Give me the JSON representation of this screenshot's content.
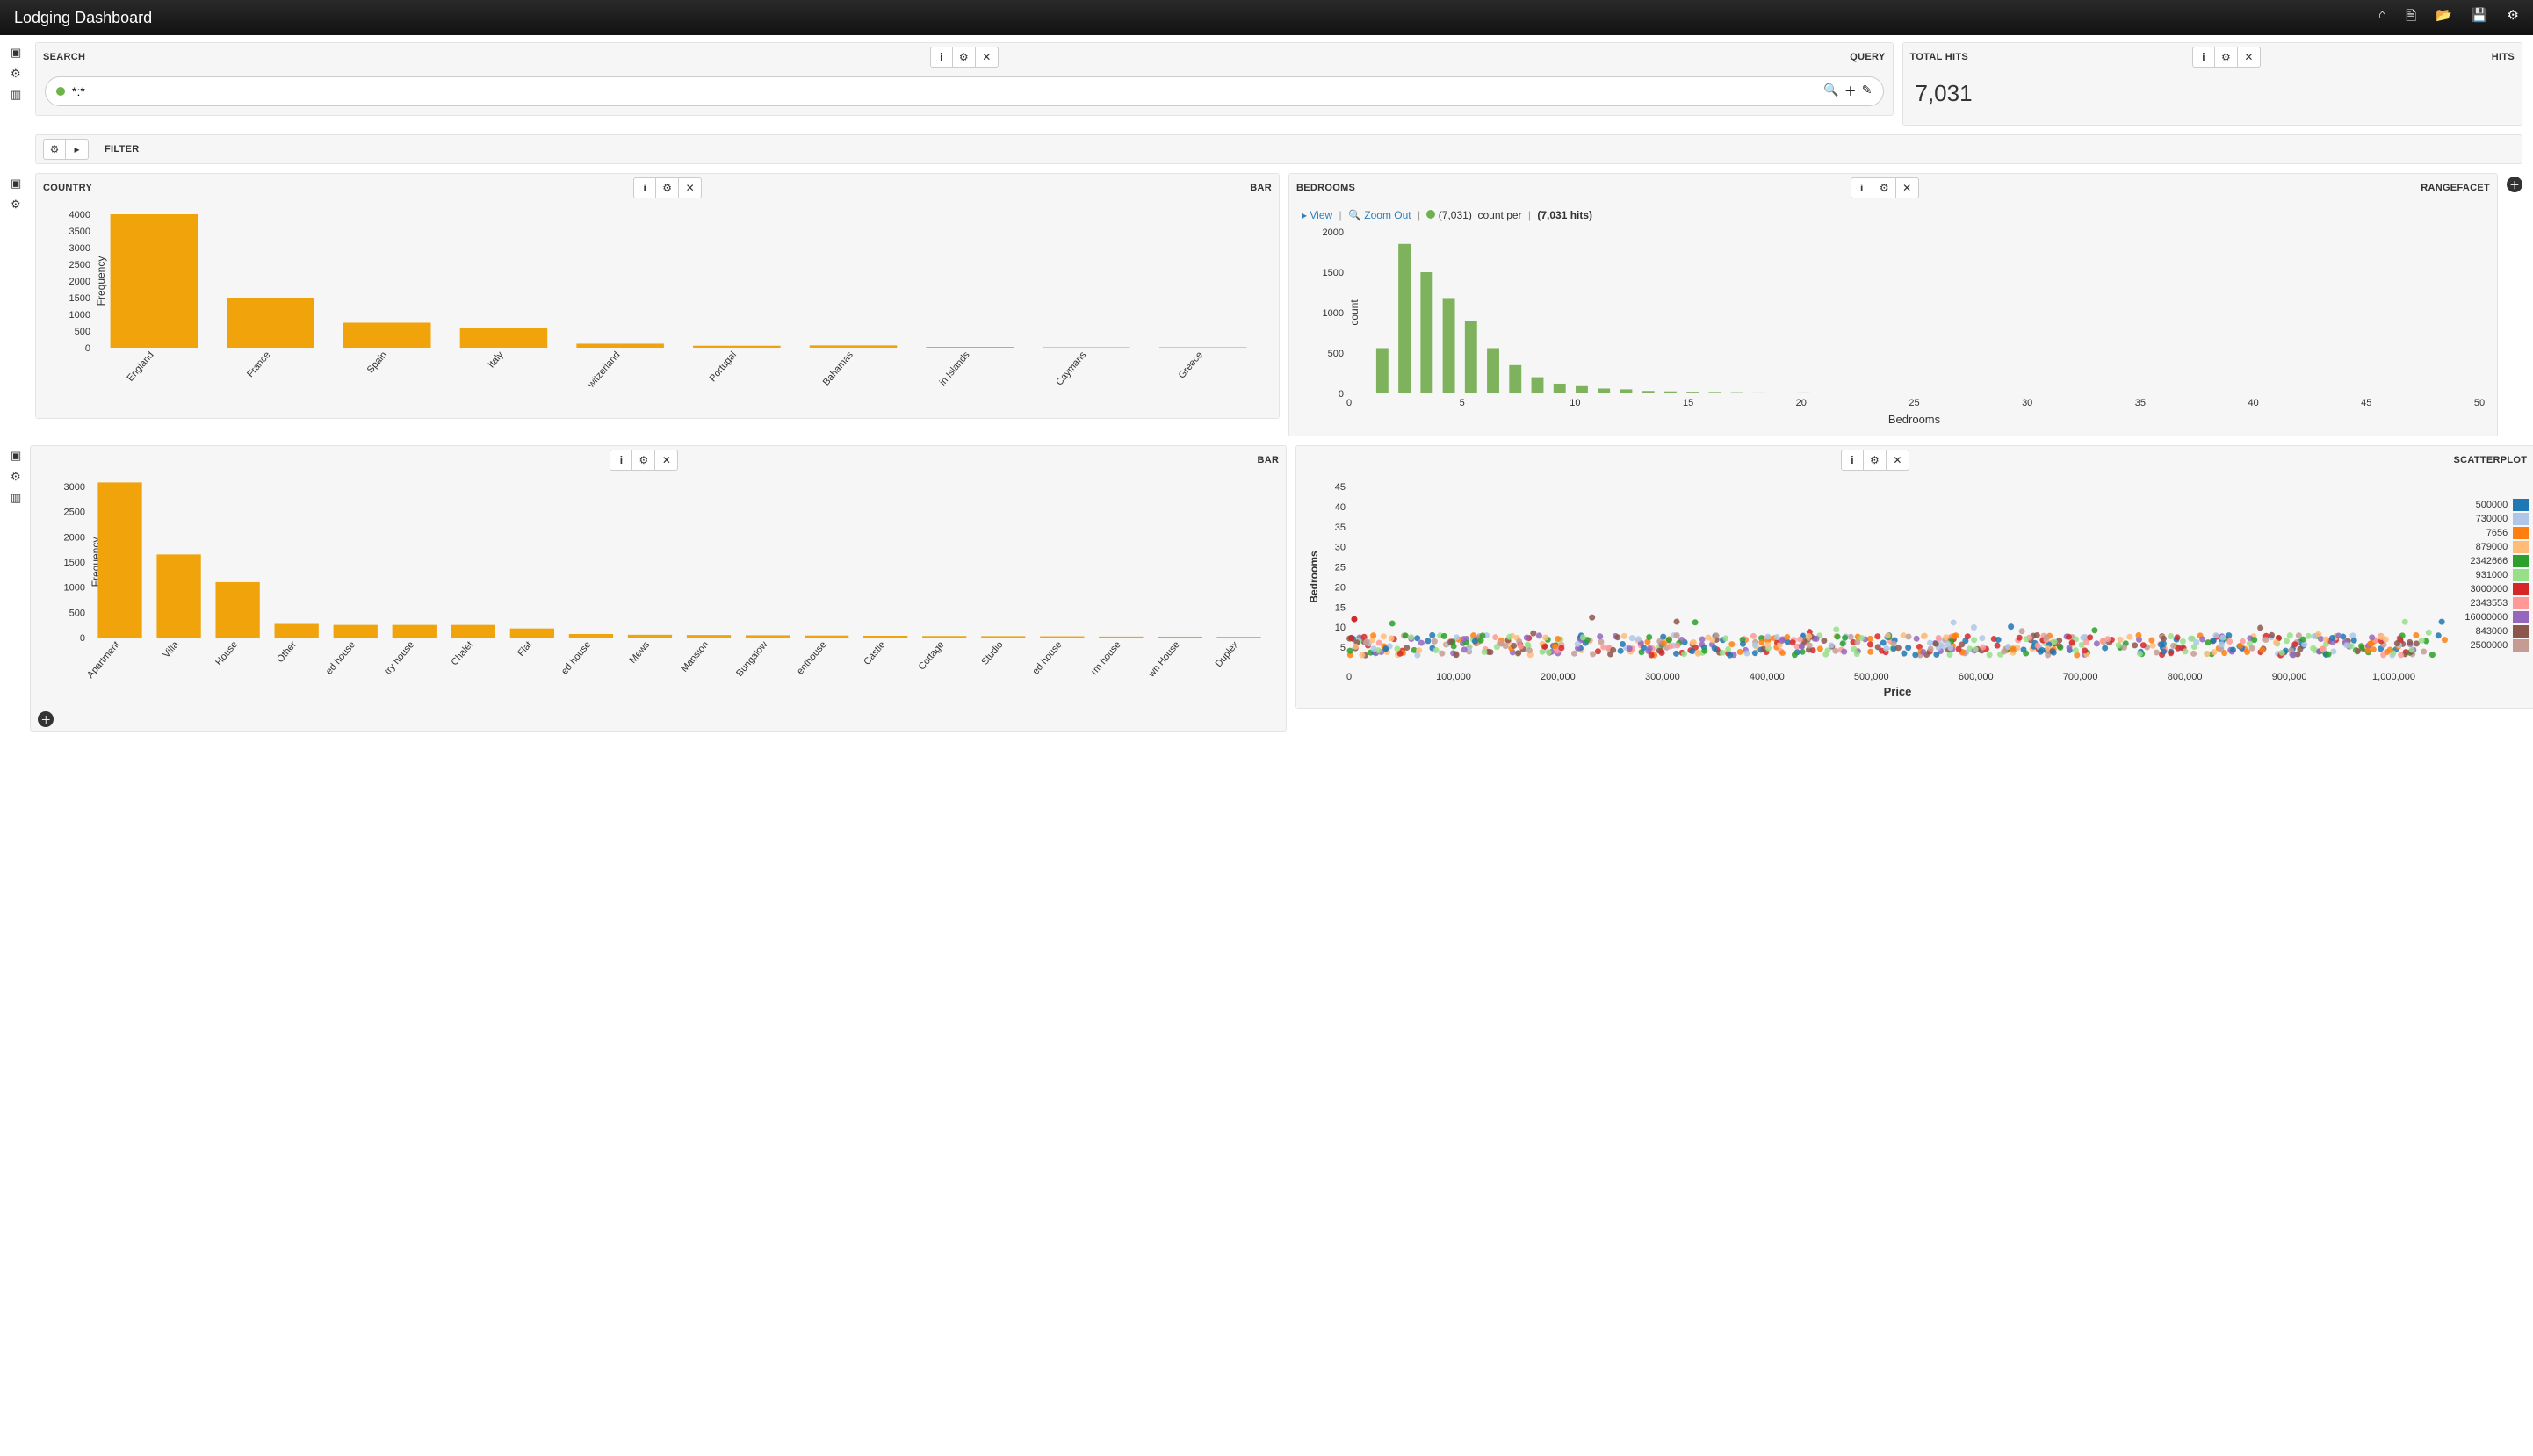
{
  "header": {
    "title": "Lodging Dashboard"
  },
  "search": {
    "title": "SEARCH",
    "tag": "QUERY",
    "value": "*:*"
  },
  "hits": {
    "title": "TOTAL HITS",
    "tag": "HITS",
    "value": "7,031"
  },
  "filter": {
    "title": "FILTER"
  },
  "country_panel": {
    "title": "COUNTRY",
    "tag": "BAR"
  },
  "bedrooms_panel": {
    "title": "BEDROOMS",
    "tag": "RANGEFACET",
    "view": "View",
    "zoom": "Zoom Out",
    "count_pre": "(7,031)",
    "count_mid": "count per",
    "count_hits": "(7,031 hits)"
  },
  "type_panel": {
    "title": "",
    "tag": "BAR"
  },
  "scatter_panel": {
    "title": "",
    "tag": "SCATTERPLOT"
  },
  "chart_data": [
    {
      "id": "country",
      "type": "bar",
      "xlabel": "",
      "ylabel": "Frequency",
      "ylim": [
        0,
        4000
      ],
      "ystep": 500,
      "categories": [
        "England",
        "France",
        "Spain",
        "Italy",
        "witzerland",
        "Portugal",
        "Bahamas",
        "in Islands",
        "Caymans",
        "Greece"
      ],
      "values": [
        4000,
        1500,
        750,
        600,
        120,
        60,
        70,
        25,
        15,
        15
      ],
      "color": "#f0a30a"
    },
    {
      "id": "bedrooms",
      "type": "bar",
      "xlabel": "Bedrooms",
      "ylabel": "count",
      "ylim": [
        0,
        2000
      ],
      "ystep": 500,
      "categories": [
        0,
        1,
        2,
        3,
        4,
        5,
        6,
        7,
        8,
        9,
        10,
        11,
        12,
        13,
        14,
        15,
        16,
        17,
        18,
        19,
        20,
        21,
        22,
        23,
        24,
        25,
        26,
        27,
        28,
        29,
        30,
        31,
        32,
        33,
        34,
        35,
        36,
        37,
        38,
        39,
        40,
        41,
        42,
        43,
        44,
        45,
        46,
        47,
        48,
        49,
        50
      ],
      "values": [
        0,
        560,
        1850,
        1500,
        1180,
        900,
        560,
        350,
        200,
        120,
        100,
        60,
        50,
        30,
        25,
        20,
        18,
        15,
        12,
        10,
        12,
        5,
        5,
        4,
        4,
        3,
        3,
        2,
        2,
        2,
        5,
        1,
        1,
        1,
        1,
        5,
        1,
        1,
        1,
        1,
        5,
        0,
        0,
        0,
        0,
        0,
        0,
        0,
        0,
        0,
        0
      ],
      "x_ticks": [
        0,
        5,
        10,
        15,
        20,
        25,
        30,
        35,
        40,
        45,
        50
      ],
      "color": "#7eb25d"
    },
    {
      "id": "type",
      "type": "bar",
      "xlabel": "",
      "ylabel": "Frequency",
      "ylim": [
        0,
        3000
      ],
      "ystep": 500,
      "categories": [
        "Apartment",
        "Villa",
        "House",
        "Other",
        "ed house",
        "try house",
        "Chalet",
        "Flat",
        "ed house",
        "Mews",
        "Mansion",
        "Bungalow",
        "enthouse",
        "Castle",
        "Cottage",
        "Studio",
        "ed house",
        "rm house",
        "wn House",
        "Duplex"
      ],
      "values": [
        3080,
        1650,
        1100,
        270,
        250,
        250,
        250,
        180,
        70,
        55,
        50,
        45,
        40,
        35,
        30,
        28,
        25,
        20,
        18,
        15
      ],
      "color": "#f0a30a"
    },
    {
      "id": "scatter",
      "type": "scatter",
      "xlabel": "Price",
      "ylabel": "Bedrooms",
      "xlim": [
        0,
        1050000
      ],
      "ylim": [
        0,
        45
      ],
      "x_ticks": [
        0,
        100000,
        200000,
        300000,
        400000,
        500000,
        600000,
        700000,
        800000,
        900000,
        1000000
      ],
      "x_tick_labels": [
        "0",
        "100,000",
        "200,000",
        "300,000",
        "400,000",
        "500,000",
        "600,000",
        "700,000",
        "800,000",
        "900,000",
        "1,000,000"
      ],
      "y_ticks": [
        5,
        10,
        15,
        20,
        25,
        30,
        35,
        40,
        45
      ],
      "legend": [
        {
          "label": "500000",
          "color": "#1f77b4"
        },
        {
          "label": "730000",
          "color": "#aec7e8"
        },
        {
          "label": "7656",
          "color": "#ff7f0e"
        },
        {
          "label": "879000",
          "color": "#ffbb78"
        },
        {
          "label": "2342666",
          "color": "#2ca02c"
        },
        {
          "label": "931000",
          "color": "#98df8a"
        },
        {
          "label": "3000000",
          "color": "#d62728"
        },
        {
          "label": "2343553",
          "color": "#ff9896"
        },
        {
          "label": "16000000",
          "color": "#9467bd"
        },
        {
          "label": "843000",
          "color": "#8c564b"
        },
        {
          "label": "2500000",
          "color": "#c49c94"
        }
      ],
      "note": "dense multi-color point cloud, majority bedrooms 3–7 across full price range; a few outliers up to ~12 bedrooms near x≈0"
    }
  ]
}
